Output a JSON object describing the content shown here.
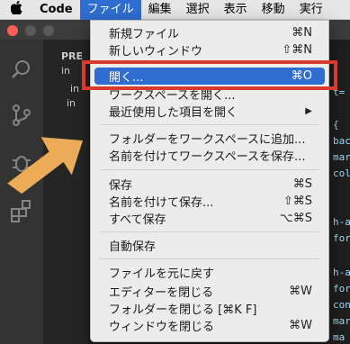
{
  "menubar": {
    "apple_icon": "",
    "items": [
      "Code",
      "ファイル",
      "編集",
      "選択",
      "表示",
      "移動",
      "実行"
    ]
  },
  "sidebar": {
    "lines": [
      "PRE",
      "in",
      "in",
      "in"
    ]
  },
  "editor": {
    "lines": [
      "t=",
      "{",
      "bac",
      "mar",
      "col",
      "h-a",
      "for",
      "h-a",
      "for",
      "con",
      "mar",
      "ma"
    ]
  },
  "file_menu": {
    "items": [
      {
        "label": "新規ファイル",
        "shortcut": "⌘N"
      },
      {
        "label": "新しいウィンドウ",
        "shortcut": "⇧⌘N"
      },
      {
        "label": "開く...",
        "shortcut": "⌘O"
      },
      {
        "label": "ワークスペースを開く...",
        "shortcut": ""
      },
      {
        "label": "最近使用した項目を開く",
        "shortcut": "▶"
      },
      {
        "label": "フォルダーをワークスペースに追加...",
        "shortcut": ""
      },
      {
        "label": "名前を付けてワークスペースを保存...",
        "shortcut": ""
      },
      {
        "label": "保存",
        "shortcut": "⌘S"
      },
      {
        "label": "名前を付けて保存...",
        "shortcut": "⇧⌘S"
      },
      {
        "label": "すべて保存",
        "shortcut": "⌥⌘S"
      },
      {
        "label": "自動保存",
        "shortcut": ""
      },
      {
        "label": "ファイルを元に戻す",
        "shortcut": ""
      },
      {
        "label": "エディターを閉じる",
        "shortcut": "⌘W"
      },
      {
        "label": "フォルダーを閉じる [⌘K F]",
        "shortcut": ""
      },
      {
        "label": "ウィンドウを閉じる",
        "shortcut": "⌘W"
      }
    ]
  },
  "colors": {
    "highlight": "#2f6dd0",
    "annotation_box": "#d63b2c",
    "annotation_arrow": "#f5b25a"
  }
}
